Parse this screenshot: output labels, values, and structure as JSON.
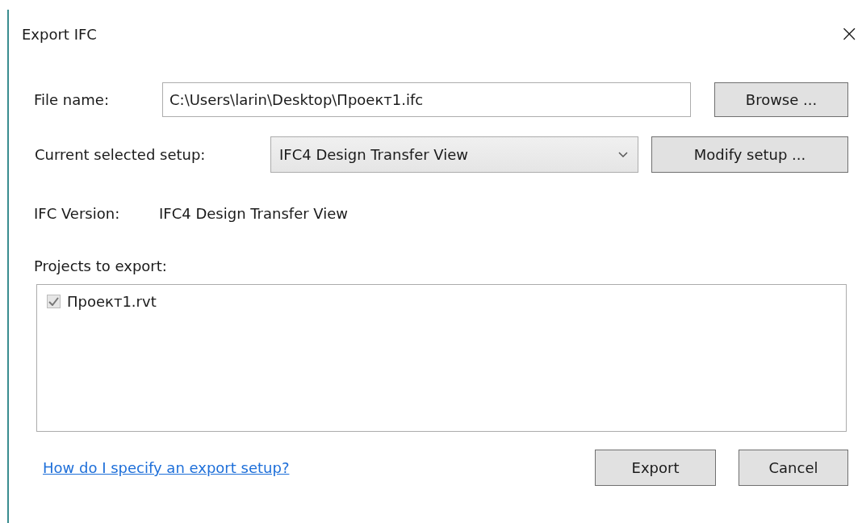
{
  "window": {
    "title": "Export IFC",
    "close": "×"
  },
  "file_name": {
    "label": "File name:",
    "value": "C:\\Users\\larin\\Desktop\\Проект1.ifc",
    "button": "Browse ..."
  },
  "setup": {
    "label": "Current selected setup:",
    "value": "IFC4 Design Transfer View",
    "button": "Modify setup ..."
  },
  "ifc_version": {
    "label": "IFC Version:",
    "value": "IFC4 Design Transfer View"
  },
  "projects": {
    "label": "Projects to export:",
    "items": [
      {
        "name": "Проект1.rvt",
        "checked": true,
        "disabled": true
      }
    ]
  },
  "help_link": "How do I specify an export setup?",
  "buttons": [
    "Export",
    "Cancel"
  ]
}
